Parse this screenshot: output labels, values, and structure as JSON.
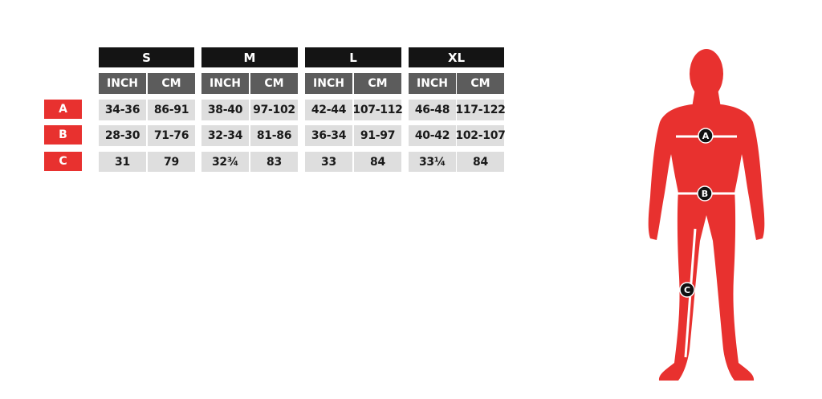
{
  "sizes": [
    {
      "label": "S",
      "units": [
        "INCH",
        "CM"
      ]
    },
    {
      "label": "M",
      "units": [
        "INCH",
        "CM"
      ]
    },
    {
      "label": "L",
      "units": [
        "INCH",
        "CM"
      ]
    },
    {
      "label": "XL",
      "units": [
        "INCH",
        "CM"
      ]
    }
  ],
  "rows": [
    {
      "label": "A",
      "cells": [
        "34-36",
        "86-91",
        "38-40",
        "97-102",
        "42-44",
        "107-112",
        "46-48",
        "117-122"
      ]
    },
    {
      "label": "B",
      "cells": [
        "28-30",
        "71-76",
        "32-34",
        "81-86",
        "36-34",
        "91-97",
        "40-42",
        "102-107"
      ]
    },
    {
      "label": "C",
      "cells": [
        "31",
        "79",
        "32¾",
        "83",
        "33",
        "84",
        "33¼",
        "84"
      ]
    }
  ],
  "figure": {
    "markers": [
      "A",
      "B",
      "C"
    ],
    "colors": {
      "body": "#e8312f",
      "line": "#ffffff",
      "marker_bg": "#111111"
    }
  }
}
